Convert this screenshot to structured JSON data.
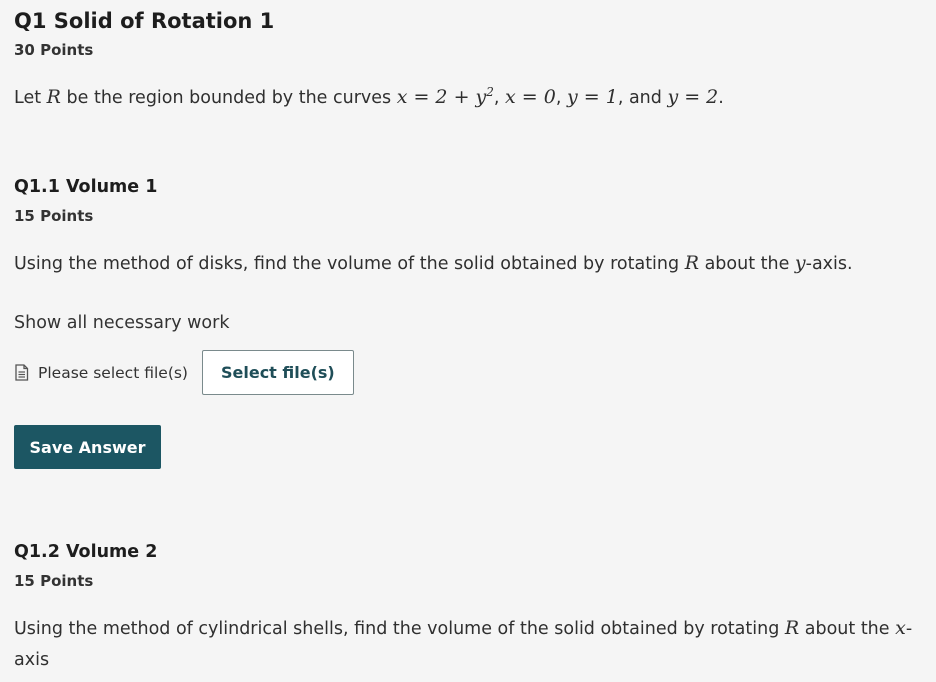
{
  "q1": {
    "title": "Q1 Solid of Rotation 1",
    "points": "30 Points",
    "prompt": {
      "lead": "Let ",
      "region": "R",
      "mid": " be the region bounded by the curves ",
      "curve_x_var": "x",
      "curve_rhs": " = 2 + y",
      "curve_exp": "2",
      "sep1": ", ",
      "c2": "x = 0",
      "sep2": ", ",
      "c3": "y = 1",
      "sep3": ", and ",
      "c4": "y = 2",
      "end": "."
    }
  },
  "q1_1": {
    "title": "Q1.1 Volume 1",
    "points": "15 Points",
    "prompt": {
      "lead": "Using the method of disks, find the volume of the solid obtained by rotating ",
      "region": "R",
      "mid": " about the ",
      "axis": "y",
      "end": "-axis."
    },
    "show_work": "Show all necessary work",
    "file_status": "Please select file(s)",
    "select_button": "Select file(s)",
    "save_button": "Save Answer"
  },
  "q1_2": {
    "title": "Q1.2 Volume 2",
    "points": "15 Points",
    "prompt": {
      "lead": "Using the method of cylindrical shells, find the volume of the solid obtained by rotating ",
      "region": "R",
      "mid": " about the ",
      "axis": "x",
      "end": "-axis"
    }
  },
  "colors": {
    "background": "#f5f5f5",
    "primary_button": "#1c5663",
    "secondary_button_text": "#1f4e58"
  },
  "icons": {
    "file_status": "file-document-icon"
  }
}
